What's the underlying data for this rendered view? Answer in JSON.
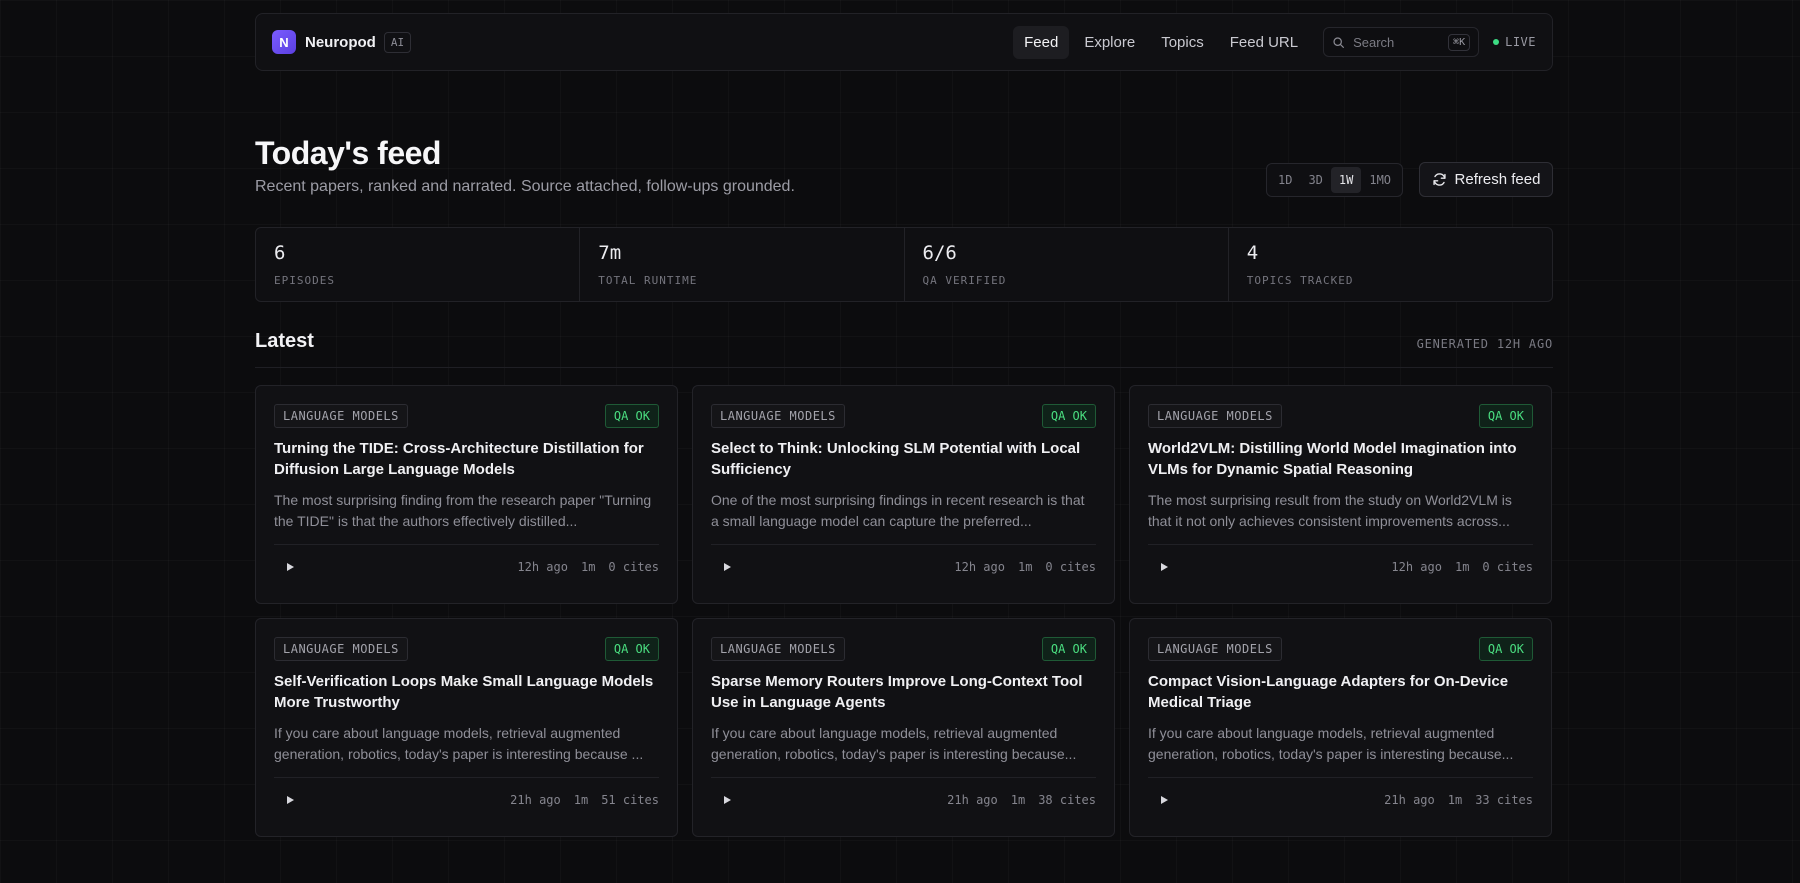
{
  "nav": {
    "logo_letter": "N",
    "brand": "Neuropod",
    "badge": "AI",
    "links": [
      {
        "label": "Feed",
        "active": true
      },
      {
        "label": "Explore",
        "active": false
      },
      {
        "label": "Topics",
        "active": false
      },
      {
        "label": "Feed URL",
        "active": false
      }
    ],
    "search_placeholder": "Search",
    "search_shortcut": "⌘K",
    "status": "LIVE"
  },
  "header": {
    "title": "Today's feed",
    "subtitle": "Recent papers, ranked and narrated. Source attached, follow-ups grounded."
  },
  "range": {
    "options": [
      "1D",
      "3D",
      "1W",
      "1MO"
    ],
    "selected": "1W"
  },
  "refresh_label": "Refresh feed",
  "stats": [
    {
      "value": "6",
      "label": "EPISODES"
    },
    {
      "value": "7m",
      "label": "TOTAL RUNTIME"
    },
    {
      "value": "6/6",
      "label": "QA VERIFIED"
    },
    {
      "value": "4",
      "label": "TOPICS TRACKED"
    }
  ],
  "latest": {
    "title": "Latest",
    "generated": "GENERATED 12H AGO"
  },
  "cards": [
    {
      "tag": "LANGUAGE MODELS",
      "qa": "QA OK",
      "title": "Turning the TIDE: Cross-Architecture Distillation for Diffusion Large Language Models",
      "excerpt": "The most surprising finding from the research paper \"Turning the TIDE\" is that the authors effectively distilled...",
      "age": "12h ago",
      "duration": "1m",
      "cites": "0 cites"
    },
    {
      "tag": "LANGUAGE MODELS",
      "qa": "QA OK",
      "title": "Select to Think: Unlocking SLM Potential with Local Sufficiency",
      "excerpt": "One of the most surprising findings in recent research is that a small language model can capture the preferred...",
      "age": "12h ago",
      "duration": "1m",
      "cites": "0 cites"
    },
    {
      "tag": "LANGUAGE MODELS",
      "qa": "QA OK",
      "title": "World2VLM: Distilling World Model Imagination into VLMs for Dynamic Spatial Reasoning",
      "excerpt": "The most surprising result from the study on World2VLM is that it not only achieves consistent improvements across...",
      "age": "12h ago",
      "duration": "1m",
      "cites": "0 cites"
    },
    {
      "tag": "LANGUAGE MODELS",
      "qa": "QA OK",
      "title": "Self-Verification Loops Make Small Language Models More Trustworthy",
      "excerpt": "If you care about language models, retrieval augmented generation, robotics, today's paper is interesting because ...",
      "age": "21h ago",
      "duration": "1m",
      "cites": "51 cites"
    },
    {
      "tag": "LANGUAGE MODELS",
      "qa": "QA OK",
      "title": "Sparse Memory Routers Improve Long-Context Tool Use in Language Agents",
      "excerpt": "If you care about language models, retrieval augmented generation, robotics, today's paper is interesting because...",
      "age": "21h ago",
      "duration": "1m",
      "cites": "38 cites"
    },
    {
      "tag": "LANGUAGE MODELS",
      "qa": "QA OK",
      "title": "Compact Vision-Language Adapters for On-Device Medical Triage",
      "excerpt": "If you care about language models, retrieval augmented generation, robotics, today's paper is interesting because...",
      "age": "21h ago",
      "duration": "1m",
      "cites": "33 cites"
    }
  ]
}
